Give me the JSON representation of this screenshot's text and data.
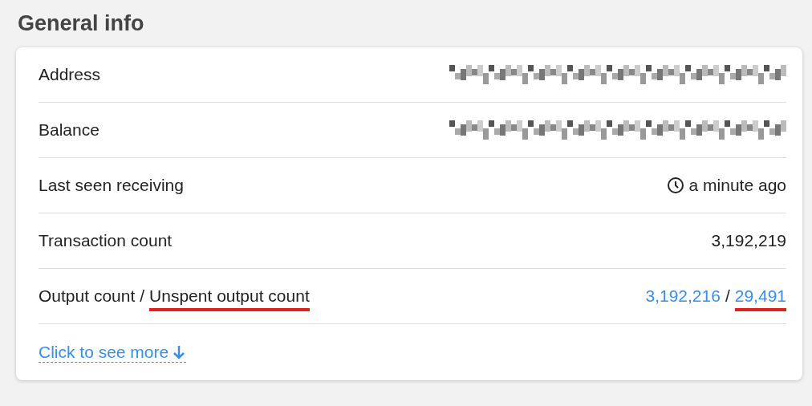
{
  "section_title": "General info",
  "rows": [
    {
      "label": [
        {
          "text": "Address",
          "underlined": false
        }
      ],
      "value": {
        "kind": "redacted"
      }
    },
    {
      "label": [
        {
          "text": "Balance",
          "underlined": false
        }
      ],
      "value": {
        "kind": "redacted"
      }
    },
    {
      "label": [
        {
          "text": "Last seen receiving",
          "underlined": false
        }
      ],
      "value": {
        "kind": "time",
        "text": "a minute ago"
      }
    },
    {
      "label": [
        {
          "text": "Transaction count",
          "underlined": false
        }
      ],
      "value": {
        "kind": "text",
        "text": "3,192,219"
      }
    },
    {
      "label": [
        {
          "text": "Output count",
          "underlined": false
        },
        {
          "text": "/",
          "underlined": false
        },
        {
          "text": "Unspent output count",
          "underlined": true
        }
      ],
      "value": {
        "kind": "links",
        "parts": [
          {
            "text": "3,192,216",
            "link": true,
            "underlined": false
          },
          {
            "text": "/",
            "link": false,
            "underlined": false
          },
          {
            "text": "29,491",
            "link": true,
            "underlined": true
          }
        ]
      }
    }
  ],
  "more_link": "Click to see more"
}
